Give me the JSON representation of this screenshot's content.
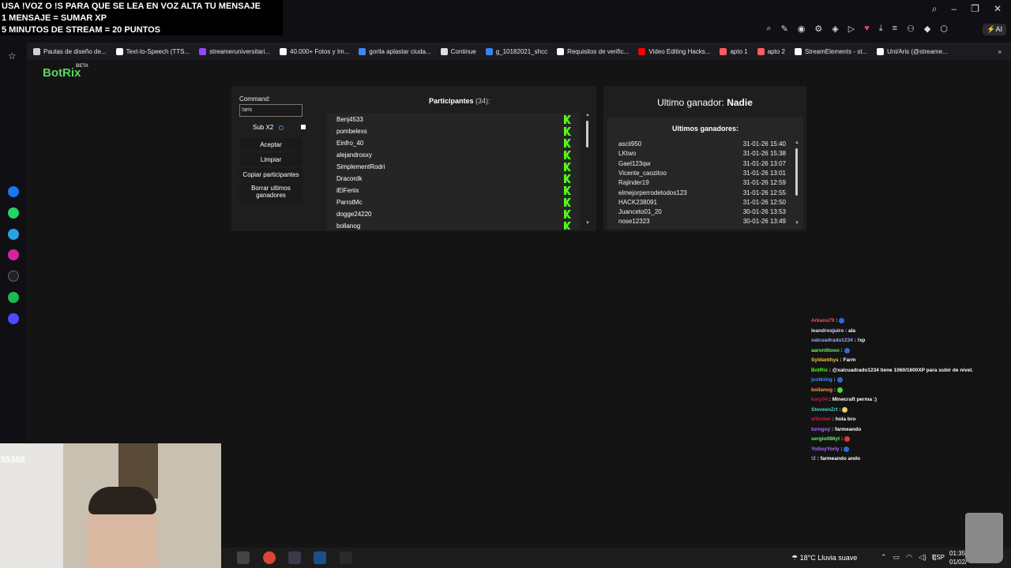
{
  "overlay": {
    "line1": "USA !VOZ O !S PARA QUE SE LEA EN VOZ ALTA TU MENSAJE",
    "line2": "1 MENSAJE = SUMAR XP",
    "line3": "5 MINUTOS DE STREAM = 20 PUNTOS"
  },
  "browser": {
    "ai_label": "AI",
    "bookmarks": [
      {
        "label": "Pautas de diseño de...",
        "color": "#d0d0d0"
      },
      {
        "label": "Text-to-Speech (TTS...",
        "color": "#ffffff"
      },
      {
        "label": "streameruniversitari...",
        "color": "#9146ff"
      },
      {
        "label": "40.000+ Fotos y Im...",
        "color": "#ffffff"
      },
      {
        "label": "gorila aplastar ciuda...",
        "color": "#4285f4"
      },
      {
        "label": "Continue",
        "color": "#dddddd"
      },
      {
        "label": "g_10182021_shcc",
        "color": "#3b82f6"
      },
      {
        "label": "Requisitos de verific...",
        "color": "#ffffff"
      },
      {
        "label": "Video Editing Hacks...",
        "color": "#ff0000"
      },
      {
        "label": "apto 1",
        "color": "#ff5a5f"
      },
      {
        "label": "apto 2",
        "color": "#ff5a5f"
      },
      {
        "label": "StreamElements - st...",
        "color": "#ffffff"
      },
      {
        "label": "Uni/Aris (@streame...",
        "color": "#ffffff"
      }
    ]
  },
  "app": {
    "logo": "BotRix",
    "logo_badge": "BETA"
  },
  "controls": {
    "command_label": "Command:",
    "command_value": "!aris",
    "sub_label": "Sub X2",
    "accept": "Aceptar",
    "clear": "Limpiar",
    "copy": "Copiar participantes",
    "delete": "Borrar ultimos ganadores"
  },
  "participants": {
    "title": "Participantes",
    "count": "(34):",
    "items": [
      "Benj4533",
      "pombelexs",
      "Einfro_40",
      "alejandrosxy",
      "SimplementRodri",
      "Dracordk",
      "iElFenix",
      "ParrotMc",
      "dogge24220",
      "bollanog"
    ]
  },
  "winners": {
    "last_label": "Ultimo ganador:",
    "last_name": "Nadie",
    "title": "Ultimos ganadores:",
    "items": [
      {
        "name": "ascii950",
        "date": "31-01-26 15:40"
      },
      {
        "name": "LKtwo",
        "date": "31-01-26 15:38"
      },
      {
        "name": "Gael123qw",
        "date": "31-01-26 13:07"
      },
      {
        "name": "Vicente_caozitoo",
        "date": "31-01-26 13:01"
      },
      {
        "name": "Rajinder19",
        "date": "31-01-26 12:59"
      },
      {
        "name": "elmejorperrodetodos123",
        "date": "31-01-26 12:55"
      },
      {
        "name": "HACK238091",
        "date": "31-01-26 12:50"
      },
      {
        "name": "Juanceto01_20",
        "date": "30-01-26 13:53"
      },
      {
        "name": "nose12323",
        "date": "30-01-26 13:49"
      }
    ]
  },
  "chat": [
    {
      "user": "Arkana79",
      "sep": " : ",
      "msg": "",
      "color": "#ff4c4c",
      "emote": "#2c6bd6"
    },
    {
      "user": "leandrosjuiro",
      "sep": " : ",
      "msg": "ala",
      "color": "#e0e0ff",
      "emote": ""
    },
    {
      "user": "xalcuadrado1234",
      "sep": " : ",
      "msg": "!xp",
      "color": "#9aa8ff",
      "emote": ""
    },
    {
      "user": "aarontitooo",
      "sep": " : ",
      "msg": "",
      "color": "#6cf06c",
      "emote": "#2c6bd6"
    },
    {
      "user": "Syldanthys",
      "sep": " : ",
      "msg": "Farm",
      "color": "#f7c948",
      "emote": ""
    },
    {
      "user": "BotRix",
      "sep": " : ",
      "msg": "@xalcuadrado1234 tiene 1060/1600XP para subir de nivel.",
      "color": "#53fc18",
      "emote": ""
    },
    {
      "user": "justkiing",
      "sep": " : ",
      "msg": "",
      "color": "#4c8cff",
      "emote": "#2c6bd6"
    },
    {
      "user": "bollanog",
      "sep": " : ",
      "msg": "",
      "color": "#ff9a4c",
      "emote": "#53d33f"
    },
    {
      "user": "kory04",
      "sep": " : ",
      "msg": "Minecraft perma :)",
      "color": "#c02050",
      "emote": ""
    },
    {
      "user": "SteveenZrt",
      "sep": " : ",
      "msg": "",
      "color": "#4cd6c6",
      "emote": "#e8d06a"
    },
    {
      "user": "elfermel",
      "sep": " : ",
      "msg": "hola bro",
      "color": "#d02040",
      "emote": ""
    },
    {
      "user": "turngoy",
      "sep": " : ",
      "msg": "farmeando",
      "color": "#b070ff",
      "emote": ""
    },
    {
      "user": "sergio086yt",
      "sep": " : ",
      "msg": "",
      "color": "#6cf06c",
      "emote": "#e03a3a"
    },
    {
      "user": "YoSoyYorly",
      "sep": " : ",
      "msg": "",
      "color": "#b070ff",
      "emote": "#2c6bd6"
    },
    {
      "user": "!2",
      "sep": " : ",
      "msg": "farmeando ando",
      "color": "#9aa8ff",
      "emote": ""
    }
  ],
  "webcam": {
    "counter": "55358"
  },
  "taskbar": {
    "temperature": "18°C",
    "weather": "Lluvia suave",
    "lang": "ESP",
    "time": "01:35",
    "date": "01/02/"
  }
}
